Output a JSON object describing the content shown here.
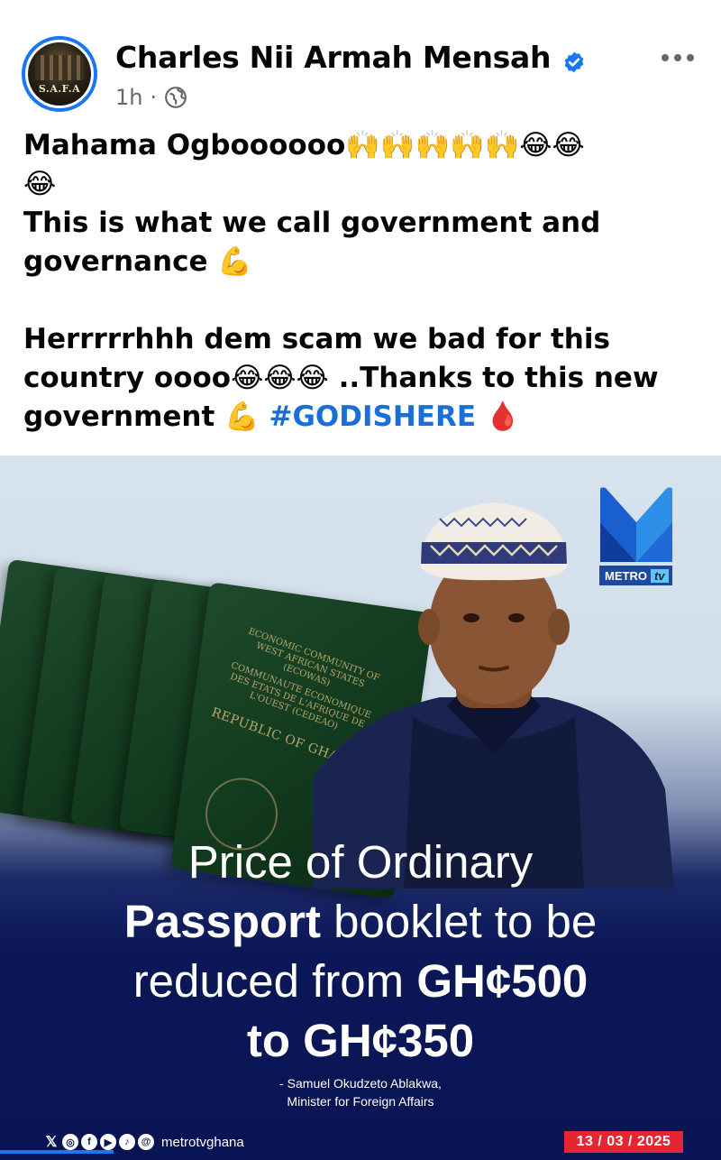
{
  "post": {
    "author": "Charles Nii Armah Mensah",
    "time": "1h",
    "separator": "·",
    "avatar_text": "S.A.F.A",
    "lines": [
      "Mahama Ogboooooo🙌🙌🙌🙌🙌😂😂",
      "😂",
      "This is what we call government and",
      "governance 💪",
      "Herrrrrhhh dem scam we bad for this",
      "country oooo😂😂😂 ..Thanks to this new",
      "government 💪"
    ],
    "hashtag": "#GODISHERE",
    "drop_emoji": "🩸"
  },
  "graphic": {
    "passport_text": {
      "community_en": "ECONOMIC COMMUNITY OF WEST AFRICAN STATES (ECOWAS)",
      "community_fr": "COMMUNAUTE ECONOMIQUE DES ETATS DE L'AFRIQUE DE L'OUEST (CEDEAO)",
      "republic": "REPUBLIC OF GHA"
    },
    "brand_badge": "METRO",
    "brand_badge_tv": "tv",
    "headline": {
      "line1": "Price of Ordinary",
      "line2_bold": "Passport",
      "line2_rest": " booklet to be",
      "line3_rest": "reduced from ",
      "line3_bold": "GH¢500",
      "line4_bold": "to GH¢350"
    },
    "quote_author": "- Samuel Okudzeto Ablakwa,",
    "quote_role": "Minister for Foreign Affairs",
    "social_handle": "metrotvghana",
    "social_icons": [
      "x-icon",
      "instagram-icon",
      "facebook-icon",
      "youtube-icon",
      "tiktok-icon",
      "threads-icon"
    ],
    "date": "13 / 03 / 2025"
  },
  "colors": {
    "verified": "#1877f2",
    "hashtag": "#1a6fd6",
    "date_badge": "#e52531",
    "graphic_navy": "#0b1757"
  }
}
